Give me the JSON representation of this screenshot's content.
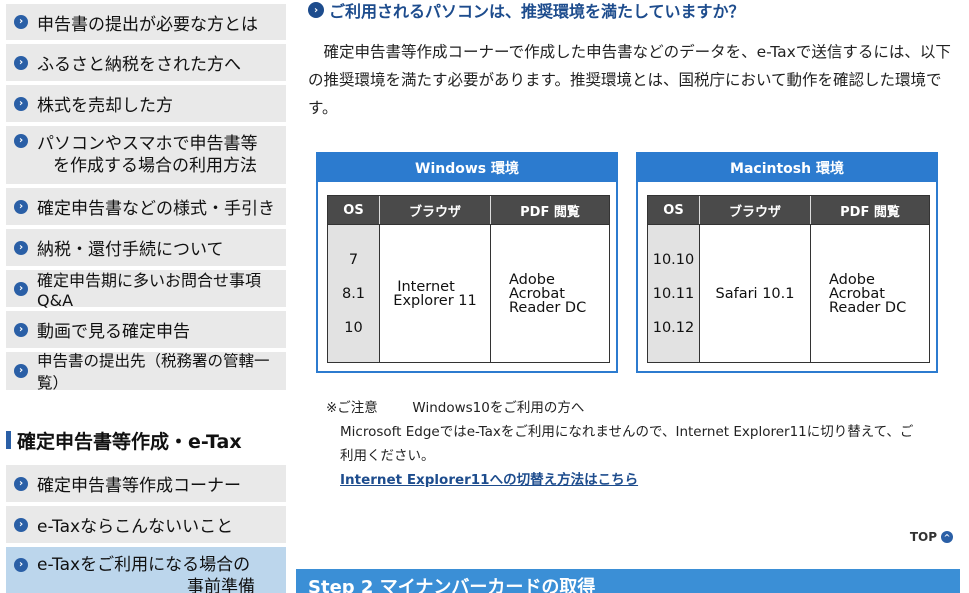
{
  "sidebar": {
    "items": [
      {
        "label": "申告書の提出が必要な方とは"
      },
      {
        "label": "ふるさと納税をされた方へ"
      },
      {
        "label": "株式を売却した方"
      },
      {
        "label_line1": "パソコンやスマホで申告書等",
        "label_line2": "を作成する場合の利用方法"
      },
      {
        "label": "確定申告書などの様式・手引き"
      },
      {
        "label": "納税・還付手続について"
      },
      {
        "label": "確定申告期に多いお問合せ事項Q&A"
      },
      {
        "label": "動画で見る確定申告"
      },
      {
        "label": "申告書の提出先（税務署の管轄一覧）"
      }
    ],
    "section_title": "確定申告書等作成・e-Tax",
    "section_items": [
      {
        "label": "確定申告書等作成コーナー"
      },
      {
        "label": "e-Taxならこんないいこと"
      },
      {
        "label_line1": "e-Taxをご利用になる場合の",
        "label_line2": "事前準備"
      }
    ]
  },
  "main": {
    "heading": "ご利用されるパソコンは、推奨環境を満たしていますか？",
    "paragraph": "確定申告書等作成コーナーで作成した申告書などのデータを、e-Taxで送信するには、以下の推奨環境を満たす必要があります。推奨環境とは、国税庁において動作を確認した環境です。",
    "windows": {
      "title": "Windows 環境",
      "headers": [
        "OS",
        "ブラウザ",
        "PDF 閲覧"
      ],
      "os": [
        "7",
        "8.1",
        "10"
      ],
      "browser_line1": "Internet",
      "browser_line2": "Explorer 11",
      "pdf_line1": "Adobe",
      "pdf_line2": "Acrobat",
      "pdf_line3": "Reader DC"
    },
    "mac": {
      "title": "Macintosh 環境",
      "headers": [
        "OS",
        "ブラウザ",
        "PDF 閲覧"
      ],
      "os": [
        "10.10",
        "10.11",
        "10.12"
      ],
      "browser": "Safari 10.1",
      "pdf_line1": "Adobe",
      "pdf_line2": "Acrobat",
      "pdf_line3": "Reader DC"
    },
    "note_label": "※ご注意",
    "note_title": "Windows10をご利用の方へ",
    "note_line1": "Microsoft Edgeではe-Taxをご利用になれませんので、Internet Explorer11に切り替えて、ご",
    "note_line2": "利用ください。",
    "note_link": "Internet Explorer11への切替え方法はこちら",
    "top_link": "TOP",
    "step_bar": "Step 2  マイナンバーカードの取得"
  },
  "colors": {
    "accent": "#2c7bcf",
    "nav_bg": "#e9e9e9",
    "nav_active": "#bcd6ec",
    "heading": "#1d4c8d"
  }
}
